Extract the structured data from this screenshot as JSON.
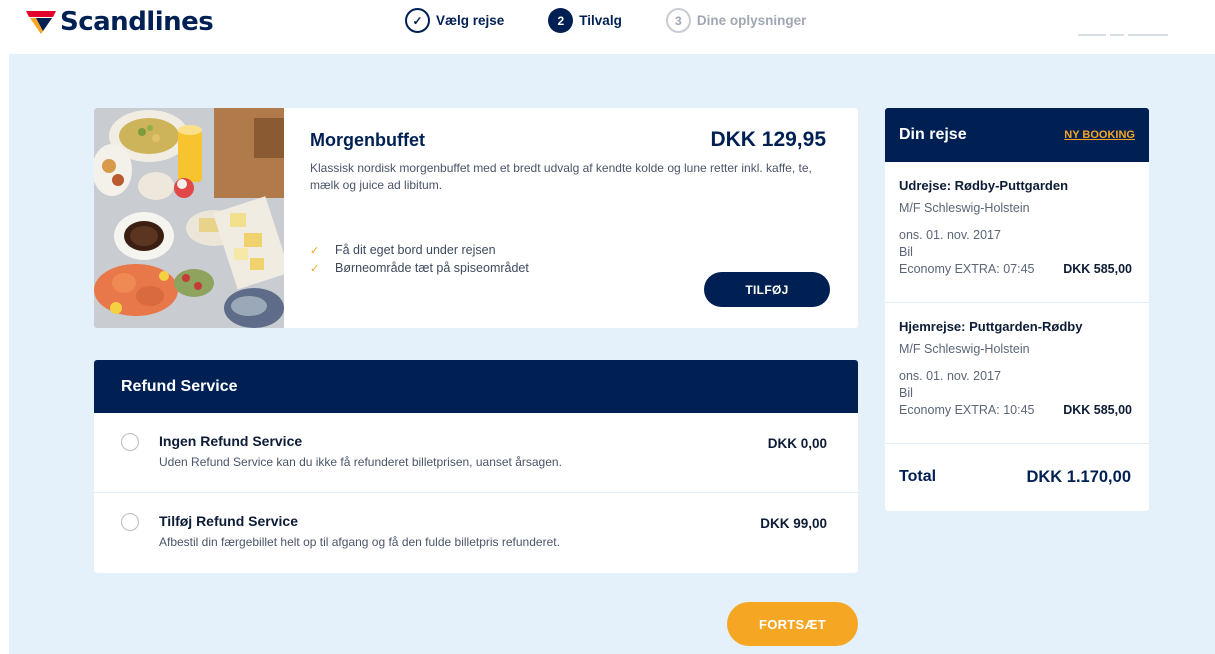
{
  "brand": {
    "name": "Scandlines"
  },
  "steps": [
    {
      "number": "1",
      "label": "Vælg rejse",
      "state": "done"
    },
    {
      "number": "2",
      "label": "Tilvalg",
      "state": "active"
    },
    {
      "number": "3",
      "label": "Dine oplysninger",
      "state": "todo"
    }
  ],
  "product": {
    "title": "Morgenbuffet",
    "price": "DKK 129,95",
    "description": "Klassisk nordisk morgenbuffet med et bredt udvalg af kendte kolde og lune retter inkl. kaffe, te, mælk og juice ad libitum.",
    "features": [
      "Få dit eget bord under rejsen",
      "Børneområde tæt på spiseområdet"
    ],
    "add_label": "TILFØJ"
  },
  "refund": {
    "heading": "Refund Service",
    "options": [
      {
        "title": "Ingen Refund Service",
        "description": "Uden Refund Service kan du ikke få refunderet billetprisen, uanset årsagen.",
        "price": "DKK 0,00",
        "selected": false
      },
      {
        "title": "Tilføj Refund Service",
        "description": "Afbestil din færgebillet helt op til afgang og få den fulde billetpris refunderet.",
        "price": "DKK 99,00",
        "selected": false
      }
    ]
  },
  "continue_label": "FORTSÆT",
  "trip": {
    "title": "Din rejse",
    "new_booking": "NY BOOKING",
    "legs": [
      {
        "title": "Udrejse: Rødby-Puttgarden",
        "ship": "M/F Schleswig-Holstein",
        "date": "ons. 01. nov. 2017",
        "vehicle": "Bil",
        "class_time": "Economy EXTRA: 07:45",
        "price": "DKK 585,00"
      },
      {
        "title": "Hjemrejse: Puttgarden-Rødby",
        "ship": "M/F Schleswig-Holstein",
        "date": "ons. 01. nov. 2017",
        "vehicle": "Bil",
        "class_time": "Economy EXTRA: 10:45",
        "price": "DKK 585,00"
      }
    ],
    "total_label": "Total",
    "total_value": "DKK 1.170,00"
  },
  "colors": {
    "navy": "#002054",
    "accent": "#f5a623",
    "background": "#e5f1fa"
  },
  "icons": {
    "step_done": "check-icon",
    "feature": "checkmark-icon",
    "logo": "scandlines-logo-icon"
  }
}
